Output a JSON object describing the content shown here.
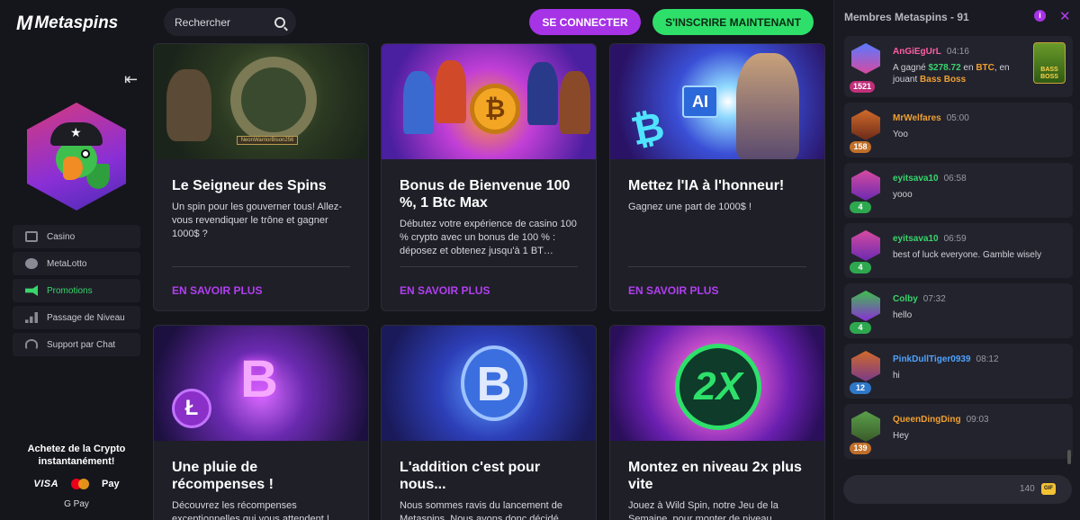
{
  "sidebar": {
    "logo_mark": "M",
    "logo_text": "Metaspins",
    "collapse_icon": "⇤",
    "nav": [
      {
        "label": "Casino",
        "icon": "casino-icon"
      },
      {
        "label": "MetaLotto",
        "icon": "lotto-icon"
      },
      {
        "label": "Promotions",
        "icon": "megaphone-icon",
        "active": true
      },
      {
        "label": "Passage de Niveau",
        "icon": "bars-icon"
      },
      {
        "label": "Support par Chat",
        "icon": "headset-icon"
      }
    ],
    "crypto_line1": "Achetez de la Crypto",
    "crypto_line2": "instantanément!",
    "pay_visa": "VISA",
    "pay_apple": " Pay",
    "pay_google": "G Pay"
  },
  "topbar": {
    "search_placeholder": "Rechercher",
    "login_label": "SE CONNECTER",
    "signup_label": "S'INSCRIRE MAINTENANT"
  },
  "promos": [
    {
      "title": "Le Seigneur des Spins",
      "desc": "Un spin pour les gouverner tous! Allez-vous revendiquer le trône et gagner 1000$ ?",
      "more": "EN SAVOIR PLUS",
      "plate": "NeonWarriorBison256"
    },
    {
      "title": "Bonus de Bienvenue 100 %, 1 Btc Max",
      "desc": "Débutez votre expérience de casino 100 % crypto avec un bonus de 100 % : déposez et obtenez jusqu'à 1 BT…",
      "more": "EN SAVOIR PLUS",
      "coin": "₿"
    },
    {
      "title": "Mettez l'IA à l'honneur!",
      "desc": "Gagnez une part de 1000$ !",
      "more": "EN SAVOIR PLUS",
      "ai": "AI",
      "btc": "₿"
    },
    {
      "title": "Une pluie de récompenses !",
      "desc": "Découvrez les récompenses exceptionnelles qui vous attendent !",
      "b": "B",
      "ltc": "Ł"
    },
    {
      "title": "L'addition c'est pour nous...",
      "desc": "Nous sommes ravis du lancement de Metaspins. Nous avons donc décidé",
      "b": "B"
    },
    {
      "title": "Montez en niveau 2x plus vite",
      "desc": "Jouez à Wild Spin, notre Jeu de la Semaine, pour monter de niveau",
      "x2": "2X"
    }
  ],
  "chat": {
    "header": "Membres Metaspins - 91",
    "info": "i",
    "close": "✕",
    "messages": [
      {
        "name": "AnGiEgUrL",
        "time": "04:16",
        "level": "1521",
        "name_color": "#ff5fa2",
        "level_color": "#c0307a",
        "pre": "A gagné ",
        "amount": "$278.72",
        "mid": " en ",
        "coin": "BTC",
        "post": ", en jouant ",
        "game": "Bass Boss",
        "thumb": "BASS BOSS"
      },
      {
        "name": "MrWelfares",
        "time": "05:00",
        "level": "158",
        "name_color": "#f0a030",
        "level_color": "#c0702a",
        "text": "Yoo"
      },
      {
        "name": "eyitsava10",
        "time": "06:58",
        "level": "4",
        "name_color": "#38d56b",
        "level_color": "#2ea84f",
        "text": "yooo"
      },
      {
        "name": "eyitsava10",
        "time": "06:59",
        "level": "4",
        "name_color": "#38d56b",
        "level_color": "#2ea84f",
        "text": "best of luck everyone. Gamble wisely"
      },
      {
        "name": "Colby",
        "time": "07:32",
        "level": "4",
        "name_color": "#38d56b",
        "level_color": "#2ea84f",
        "text": "hello"
      },
      {
        "name": "PinkDullTiger0939",
        "time": "08:12",
        "level": "12",
        "name_color": "#4fa3ff",
        "level_color": "#2f78c8",
        "text": "hi"
      },
      {
        "name": "QueenDingDing",
        "time": "09:03",
        "level": "139",
        "name_color": "#f0a030",
        "level_color": "#c0702a",
        "text": "Hey"
      }
    ],
    "char_count": "140",
    "gif_label": "GIF"
  }
}
